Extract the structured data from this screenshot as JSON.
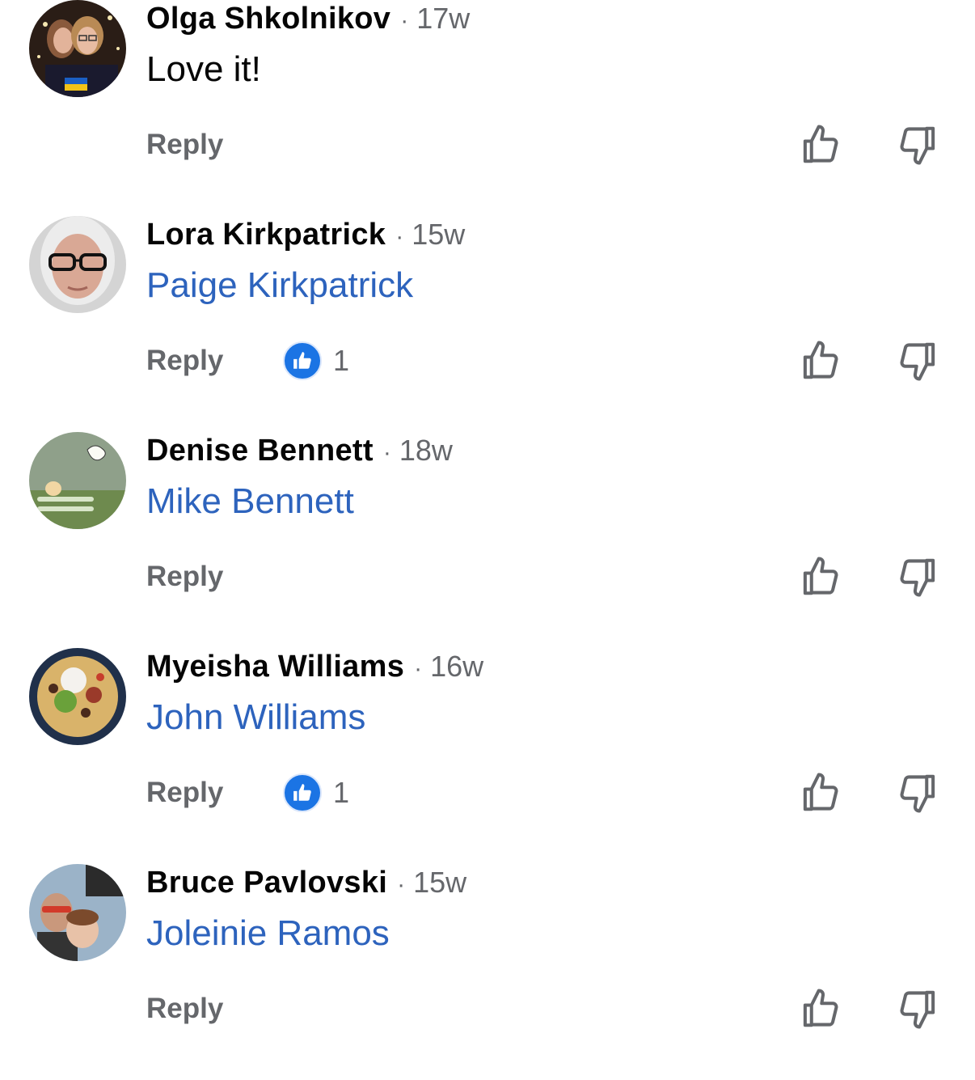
{
  "comments": [
    {
      "name": "Olga Shkolnikov",
      "time": "17w",
      "text": "Love it!",
      "text_type": "plain",
      "reply_label": "Reply",
      "like_count": null
    },
    {
      "name": "Lora Kirkpatrick",
      "time": "15w",
      "text": "Paige Kirkpatrick",
      "text_type": "mention",
      "reply_label": "Reply",
      "like_count": "1"
    },
    {
      "name": "Denise Bennett",
      "time": "18w",
      "text": "Mike Bennett",
      "text_type": "mention",
      "reply_label": "Reply",
      "like_count": null
    },
    {
      "name": "Myeisha Williams",
      "time": "16w",
      "text": "John Williams",
      "text_type": "mention",
      "reply_label": "Reply",
      "like_count": "1"
    },
    {
      "name": "Bruce Pavlovski",
      "time": "15w",
      "text": "Joleinie Ramos",
      "text_type": "mention",
      "reply_label": "Reply",
      "like_count": null
    }
  ],
  "separator": "·",
  "icons": {
    "upvote": "thumbs-up-outline-icon",
    "downvote": "thumbs-down-outline-icon",
    "like_badge": "like-reaction-icon"
  },
  "colors": {
    "mention": "#2d63bd",
    "secondary_text": "#65676b",
    "like_blue": "#1b74e4"
  }
}
